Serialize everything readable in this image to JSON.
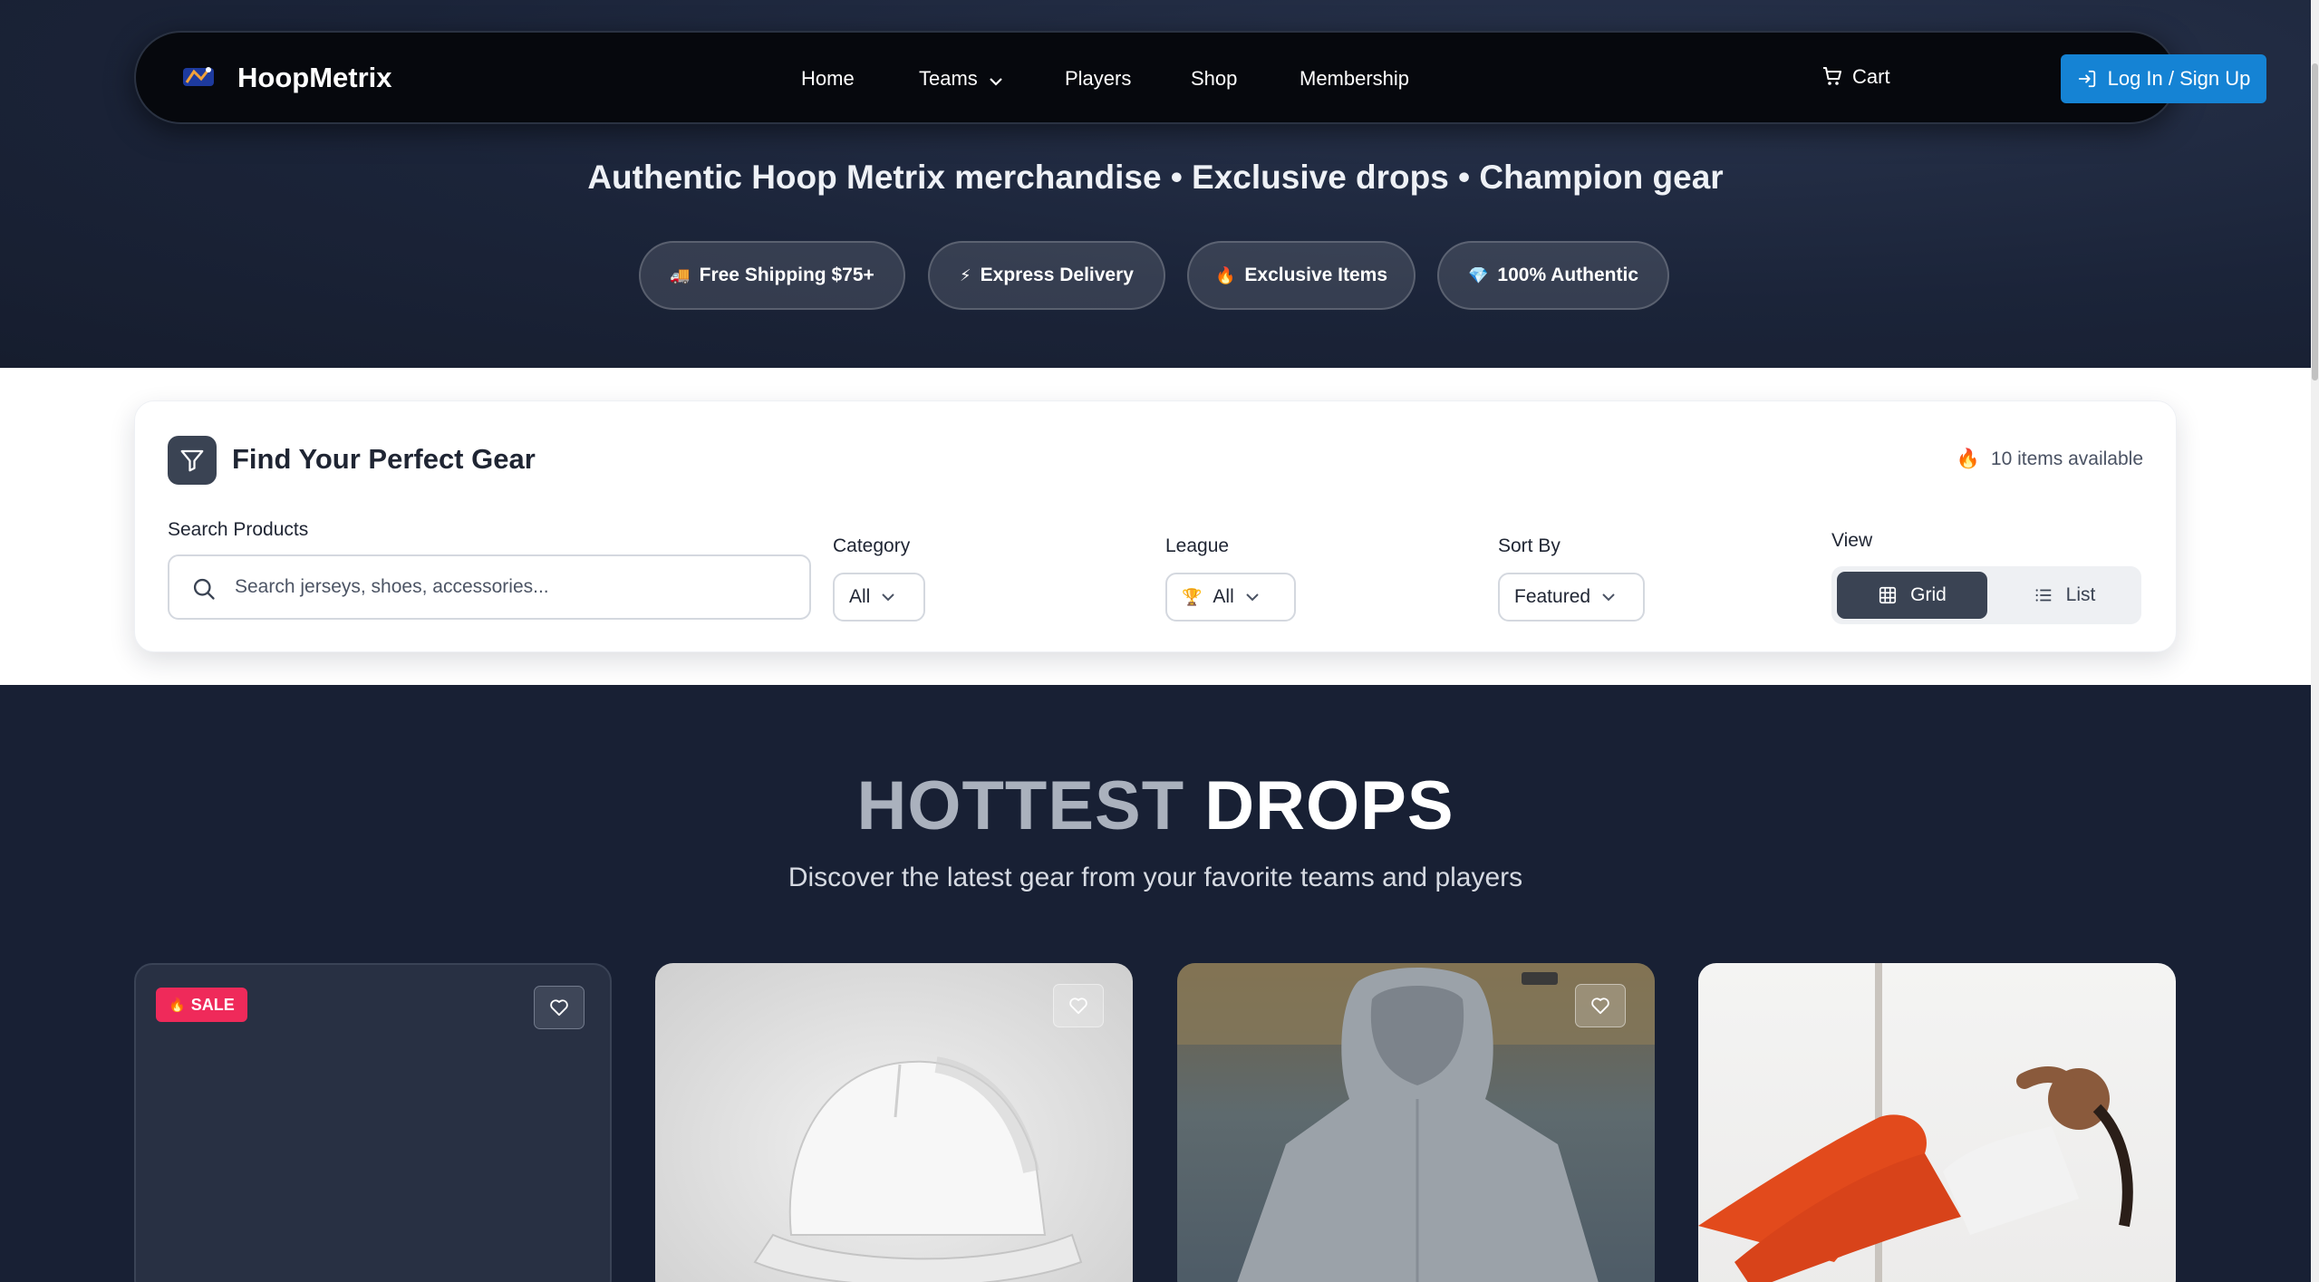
{
  "nav": {
    "brand": "HoopMetrix",
    "links": [
      "Home",
      "Teams",
      "Players",
      "Shop",
      "Membership"
    ],
    "cart": "Cart",
    "login": "Log In / Sign Up"
  },
  "hero": {
    "tagline": "Authentic Hoop Metrix merchandise • Exclusive drops • Champion gear",
    "badges": [
      {
        "icon": "🚚",
        "label": "Free Shipping $75+"
      },
      {
        "icon": "⚡",
        "label": "Express Delivery"
      },
      {
        "icon": "🔥",
        "label": "Exclusive Items"
      },
      {
        "icon": "💎",
        "label": "100% Authentic"
      }
    ]
  },
  "filters": {
    "title": "Find Your Perfect Gear",
    "available": "10 items available",
    "available_icon": "🔥",
    "search_label": "Search Products",
    "search_placeholder": "Search jerseys, shoes, accessories...",
    "category_label": "Category",
    "category_value": "All",
    "league_label": "League",
    "league_icon": "🏆",
    "league_value": "All",
    "sort_label": "Sort By",
    "sort_value": "Featured",
    "view_label": "View",
    "view_grid": "Grid",
    "view_list": "List"
  },
  "drops": {
    "title_a": "HOTTEST",
    "title_b": "DROPS",
    "subtitle": "Discover the latest gear from your favorite teams and players",
    "sale_badge": "SALE",
    "sale_icon": "🔥"
  },
  "colors": {
    "accent": "#1583d4",
    "sale": "#ef2a5a",
    "dark": "#3a4353"
  }
}
